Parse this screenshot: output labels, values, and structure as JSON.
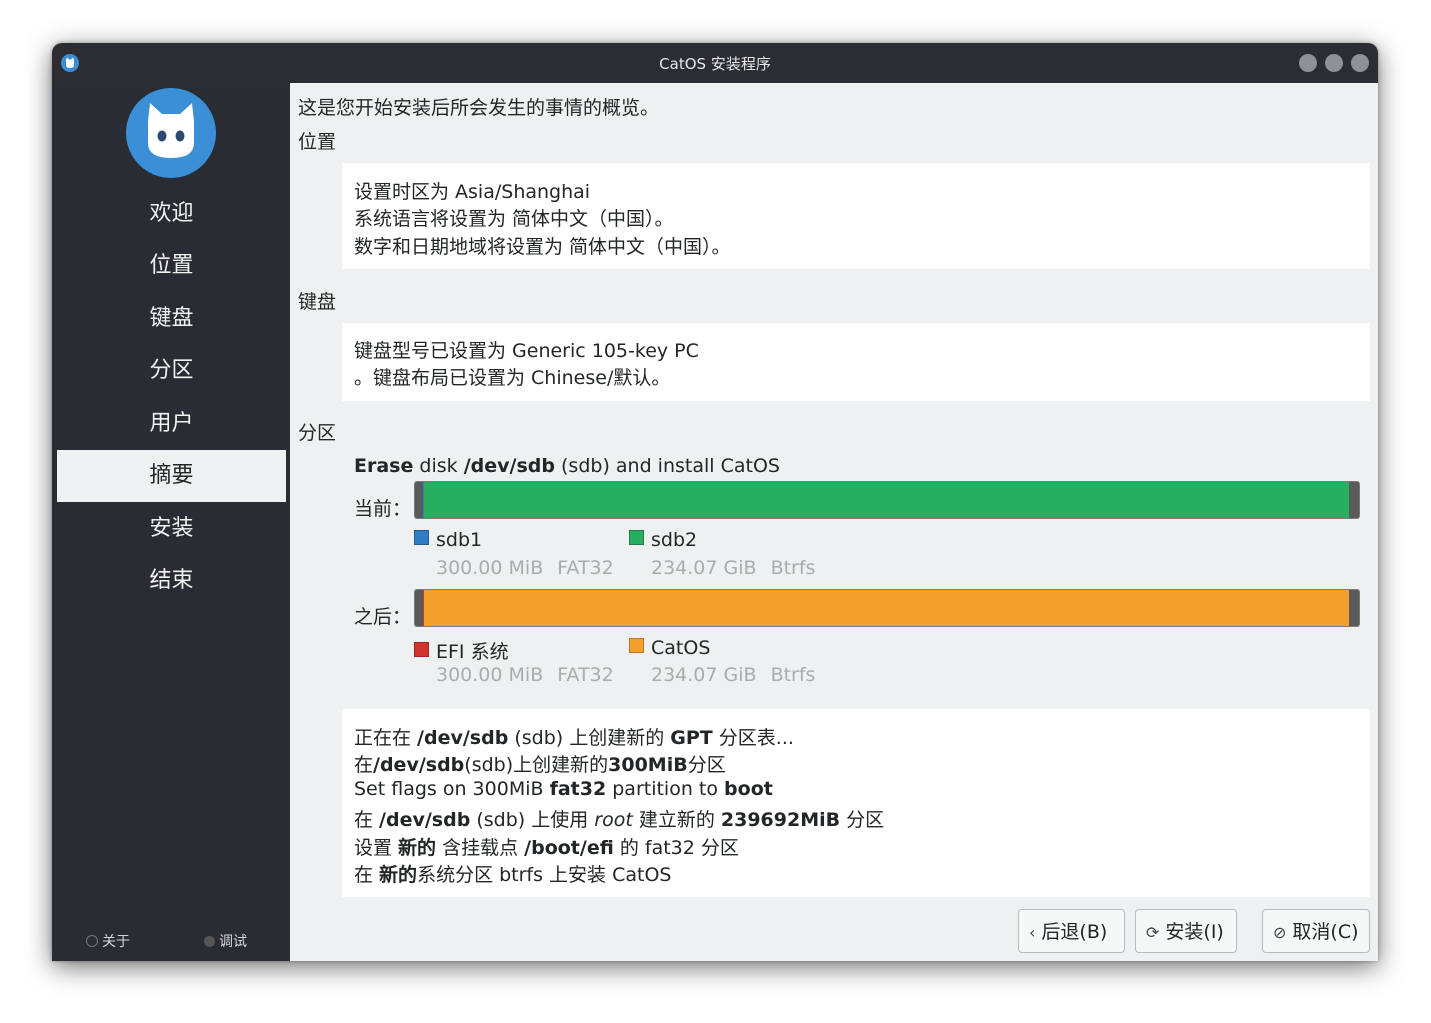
{
  "window": {
    "title": "CatOS 安装程序"
  },
  "sidebar": {
    "items": [
      {
        "label": "欢迎",
        "active": false
      },
      {
        "label": "位置",
        "active": false
      },
      {
        "label": "键盘",
        "active": false
      },
      {
        "label": "分区",
        "active": false
      },
      {
        "label": "用户",
        "active": false
      },
      {
        "label": "摘要",
        "active": true
      },
      {
        "label": "安装",
        "active": false
      },
      {
        "label": "结束",
        "active": false
      }
    ],
    "footer": {
      "about_label": "关于",
      "debug_label": "调试"
    }
  },
  "summary": {
    "intro": "这是您开始安装后所会发生的事情的概览。",
    "location": {
      "heading": "位置",
      "lines": [
        "设置时区为 Asia/Shanghai",
        "系统语言将设置为 简体中文（中国）。",
        "数字和日期地域将设置为 简体中文（中国）。"
      ]
    },
    "keyboard": {
      "heading": "键盘",
      "lines": [
        "键盘型号已设置为 Generic 105-key PC",
        "。键盘布局已设置为 Chinese/默认。"
      ]
    },
    "partition": {
      "heading": "分区",
      "title_bold_1": "Erase",
      "title_text_1": " disk ",
      "title_bold_2": "/dev/sdb",
      "title_text_2": " (sdb) and install CatOS",
      "current_label": "当前：",
      "after_label": "之后：",
      "current_parts": [
        {
          "name": "sdb1",
          "size": "300.00 MiB",
          "fs": "FAT32",
          "color": "#2d7ec4"
        },
        {
          "name": "sdb2",
          "size": "234.07 GiB",
          "fs": "Btrfs",
          "color": "#27ae60"
        }
      ],
      "after_parts": [
        {
          "name": "EFI 系统",
          "size": "300.00 MiB",
          "fs": "FAT32",
          "color": "#d0342c"
        },
        {
          "name": "CatOS",
          "size": "234.07 GiB",
          "fs": "Btrfs",
          "color": "#f4a02c"
        }
      ],
      "jobs": [
        {
          "a": "正在在 ",
          "b": "/dev/sdb",
          "c": " (sdb) 上创建新的 ",
          "d": "GPT",
          "e": " 分区表..."
        },
        {
          "a": "在",
          "b": "/dev/sdb",
          "c": "(sdb)上创建新的",
          "d": "300MiB",
          "e": "分区"
        },
        {
          "a": "Set flags on 300MiB ",
          "b": "fat32",
          "c": " partition to ",
          "d": "boot",
          "e": ""
        },
        {
          "a": "在 ",
          "b": "/dev/sdb",
          "c": " (sdb) 上使用 ",
          "i": "root",
          "c2": " 建立新的 ",
          "d": "239692MiB",
          "e": " 分区"
        },
        {
          "a": "设置 ",
          "b": "新的",
          "c": " 含挂载点 ",
          "d": "/boot/efi",
          "e": " 的 fat32 分区"
        },
        {
          "a": "在 ",
          "b": "新的",
          "c": "系统分区 btrfs 上安装 CatOS",
          "d": "",
          "e": ""
        }
      ]
    }
  },
  "buttons": {
    "back": "后退(B)",
    "install": "安装(I)",
    "cancel": "取消(C)"
  }
}
